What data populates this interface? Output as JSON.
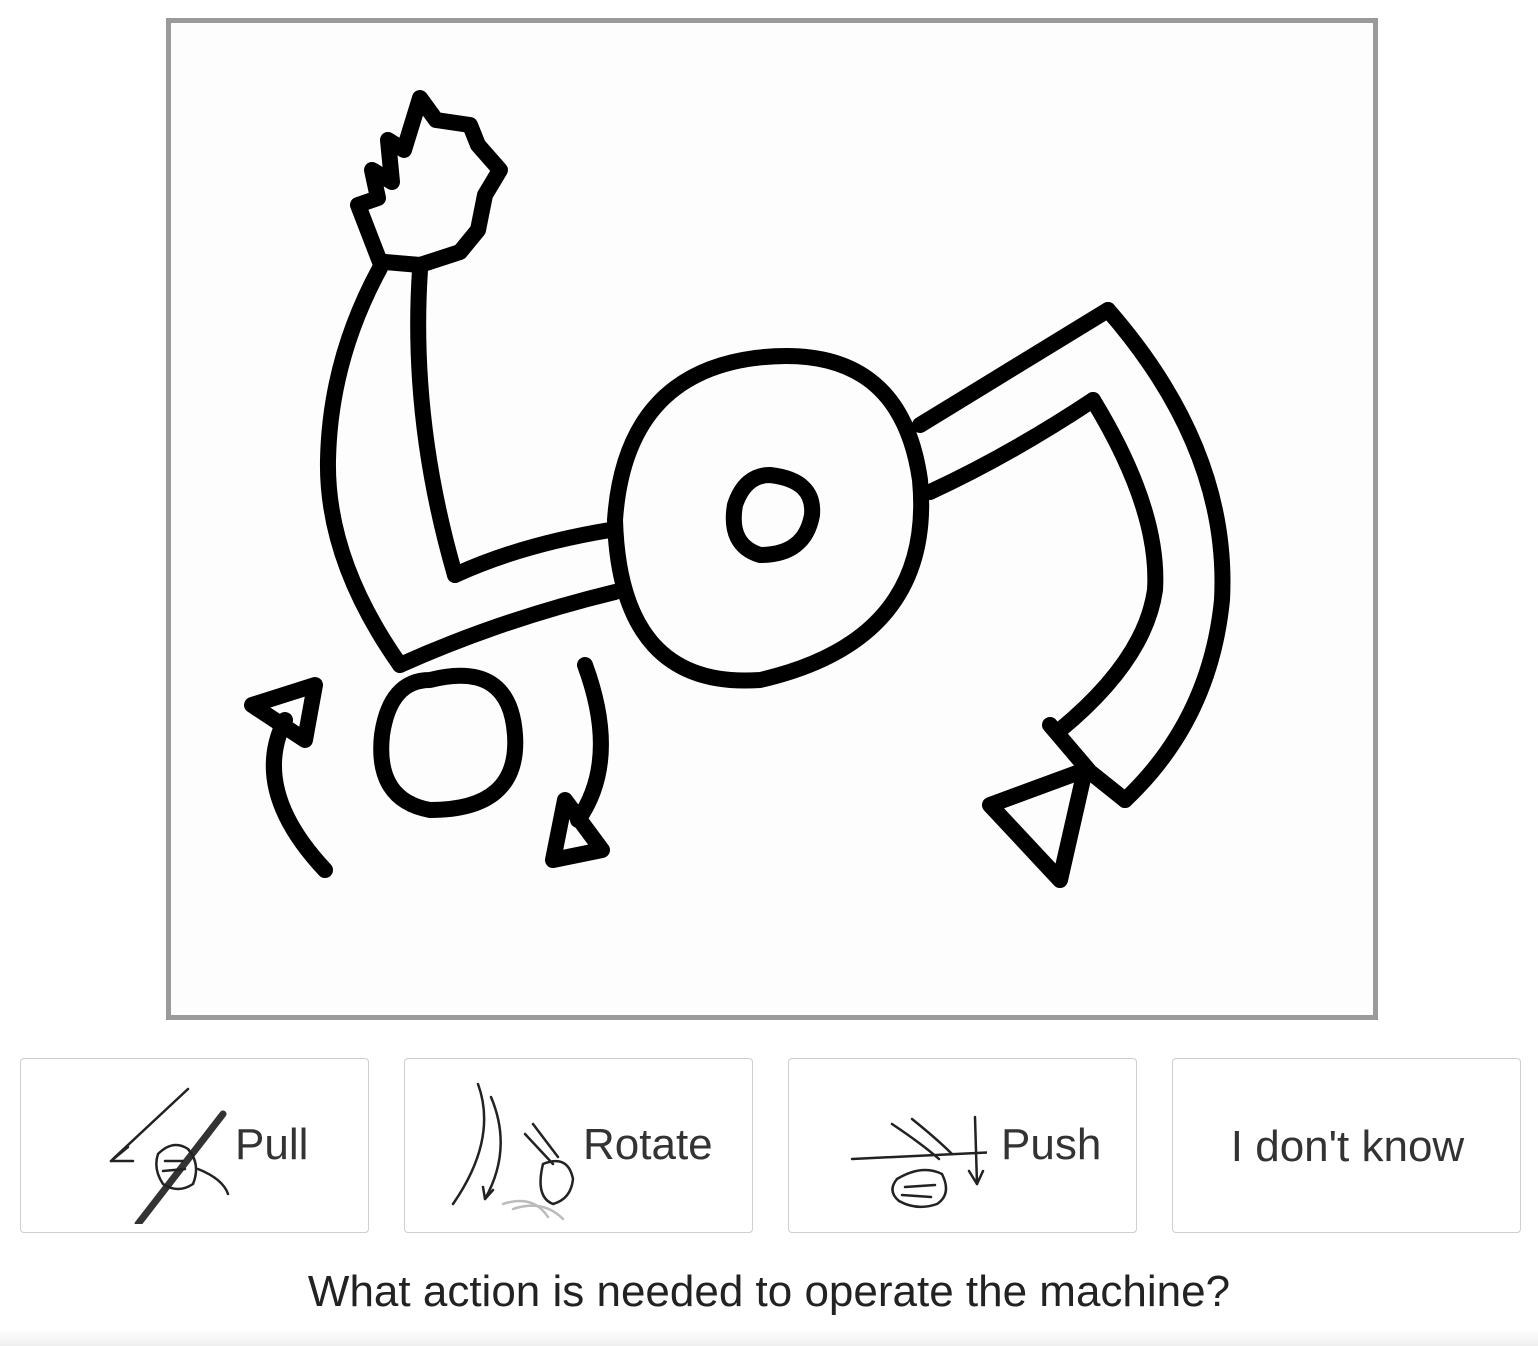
{
  "drawing": {
    "subject": "sketch-of-machine-with-crank-arms-and-wheel"
  },
  "choices": [
    {
      "label": "Pull",
      "icon": "pull-hand-rope-icon"
    },
    {
      "label": "Rotate",
      "icon": "rotate-hand-icon"
    },
    {
      "label": "Push",
      "icon": "push-hand-icon"
    },
    {
      "label": "I don't know"
    }
  ],
  "question": "What action is needed to operate the machine?",
  "colors": {
    "frame_border": "#9a9a9a",
    "button_border": "#cfcfcf",
    "text": "#333333",
    "ink": "#000000"
  }
}
